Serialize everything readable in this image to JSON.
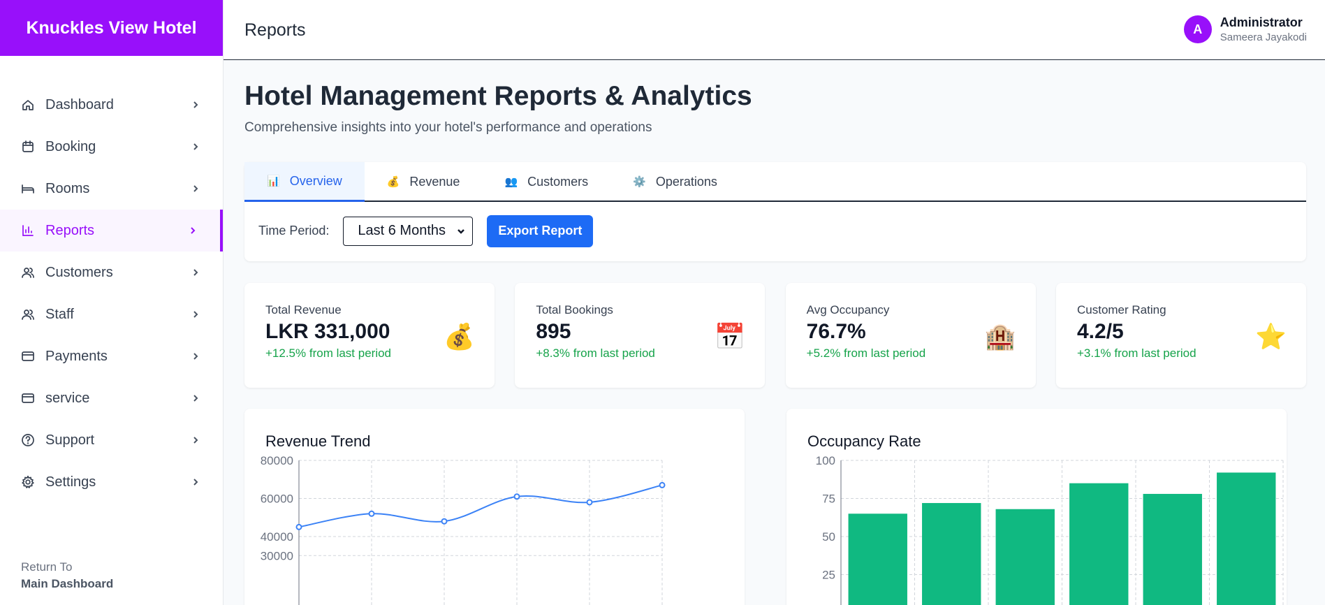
{
  "sidebar": {
    "brand": "Knuckles View Hotel",
    "items": [
      {
        "label": "Dashboard",
        "icon": "home-icon"
      },
      {
        "label": "Booking",
        "icon": "calendar-icon"
      },
      {
        "label": "Rooms",
        "icon": "bed-icon"
      },
      {
        "label": "Reports",
        "icon": "bar-chart-icon"
      },
      {
        "label": "Customers",
        "icon": "users-icon"
      },
      {
        "label": "Staff",
        "icon": "users-icon"
      },
      {
        "label": "Payments",
        "icon": "credit-card-icon"
      },
      {
        "label": "service",
        "icon": "credit-card-icon"
      },
      {
        "label": "Support",
        "icon": "help-circle-icon"
      },
      {
        "label": "Settings",
        "icon": "gear-icon"
      }
    ],
    "active_item": "Reports",
    "return_line1": "Return To",
    "return_line2": "Main Dashboard"
  },
  "header": {
    "title": "Reports",
    "user_initial": "A",
    "user_name": "Administrator",
    "user_sub": "Sameera Jayakodi"
  },
  "main": {
    "title": "Hotel Management Reports & Analytics",
    "subtitle": "Comprehensive insights into your hotel's performance and operations",
    "tabs": [
      {
        "label": "Overview",
        "emoji": "📊"
      },
      {
        "label": "Revenue",
        "emoji": "💰"
      },
      {
        "label": "Customers",
        "emoji": "👥"
      },
      {
        "label": "Operations",
        "emoji": "⚙️"
      }
    ],
    "active_tab": "Overview",
    "time_period_label": "Time Period:",
    "time_period_value": "Last 6 Months",
    "export_label": "Export Report"
  },
  "stats": [
    {
      "label": "Total Revenue",
      "value": "LKR 331,000",
      "change": "+12.5% from last period",
      "emoji": "💰"
    },
    {
      "label": "Total Bookings",
      "value": "895",
      "change": "+8.3% from last period",
      "emoji": "📅"
    },
    {
      "label": "Avg Occupancy",
      "value": "76.7%",
      "change": "+5.2% from last period",
      "emoji": "🏨"
    },
    {
      "label": "Customer Rating",
      "value": "4.2/5",
      "change": "+3.1% from last period",
      "emoji": "⭐"
    }
  ],
  "colors": {
    "brand": "#9810fa",
    "primary": "#1d6bf5",
    "positive": "#16a34a",
    "line": "#3b82f6",
    "bar": "#10b981"
  },
  "chart_data": [
    {
      "type": "line",
      "title": "Revenue Trend",
      "values": [
        45000,
        52000,
        48000,
        61000,
        58000,
        67000
      ],
      "ylim": [
        20000,
        80000
      ],
      "yticks": [
        30000,
        40000,
        60000,
        80000
      ],
      "ytick_labels": [
        "30000",
        "40000",
        "60000",
        "80000"
      ]
    },
    {
      "type": "bar",
      "title": "Occupancy Rate",
      "values": [
        65,
        72,
        68,
        85,
        78,
        92
      ],
      "ylim": [
        25,
        100
      ],
      "yticks": [
        25,
        50,
        75,
        100
      ],
      "ytick_labels": [
        "25",
        "50",
        "75",
        "100"
      ]
    }
  ]
}
